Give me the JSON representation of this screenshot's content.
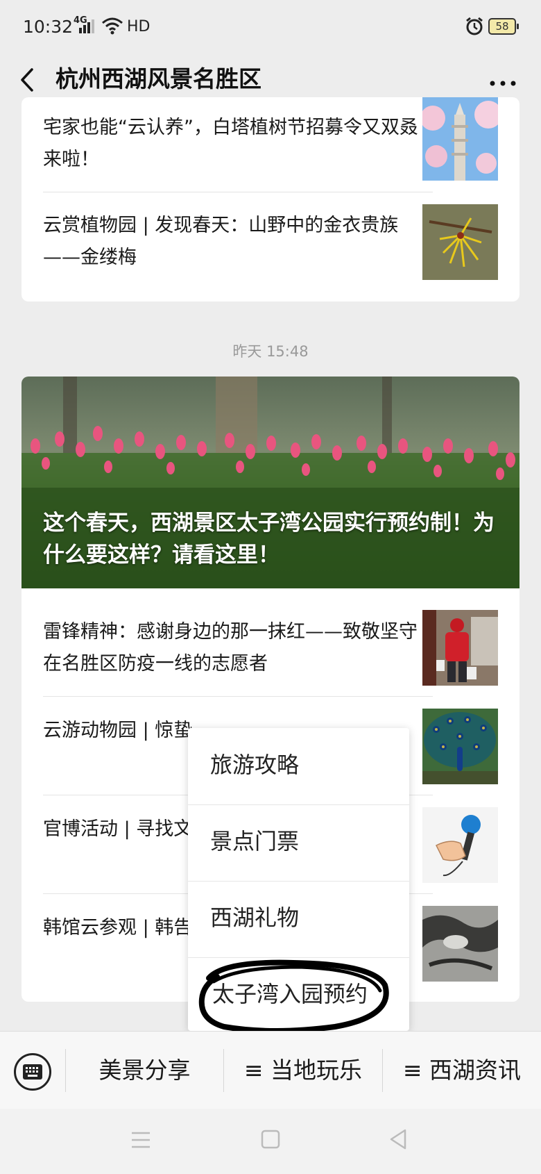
{
  "status_bar": {
    "time": "10:32",
    "network": "4G",
    "hd": "HD",
    "battery": "58"
  },
  "header": {
    "title": "杭州西湖风景名胜区"
  },
  "card1": {
    "articles": [
      {
        "title": "宅家也能“云认养”，白塔植树节招募令又双叒来啦！",
        "thumb": "white-pagoda-photo"
      },
      {
        "title": "云赏植物园 | 发现春天：山野中的金衣贵族——金缕梅",
        "thumb": "witch-hazel-flower-photo"
      }
    ]
  },
  "timestamp": "昨天 15:48",
  "card2": {
    "hero_title": "这个春天，西湖景区太子湾公园实行预约制！为什么要这样？请看这里！",
    "articles": [
      {
        "title": "雷锋精神：感谢身边的那一抹红——致敬坚守在名胜区防疫一线的志愿者",
        "thumb": "volunteer-photo"
      },
      {
        "title": "云游动物园 | 惊蛰",
        "thumb": "peacock-photo"
      },
      {
        "title": "官博活动 | 寻找文物代言！（第",
        "thumb": "microphone-illustration"
      },
      {
        "title": "韩馆云参观 | 韩告诉我，韩美林",
        "thumb": "ink-painting-photo"
      }
    ]
  },
  "popup_menu": {
    "items": [
      "旅游攻略",
      "景点门票",
      "西湖礼物",
      "太子湾入园预约"
    ]
  },
  "bottom_menu": {
    "items": [
      "美景分享",
      "≡ 当地玩乐",
      "≡ 西湖资讯"
    ]
  },
  "icons": {
    "back": "chevron-left-icon",
    "more": "more-dots-icon",
    "keyboard": "keyboard-icon",
    "nav_menu": "menu-icon",
    "nav_home": "home-square-icon",
    "nav_back": "back-triangle-icon"
  },
  "colors": {
    "background": "#ededed",
    "card": "#ffffff",
    "hero_overlay_text": "#ffffff",
    "annotation": "#000000"
  }
}
